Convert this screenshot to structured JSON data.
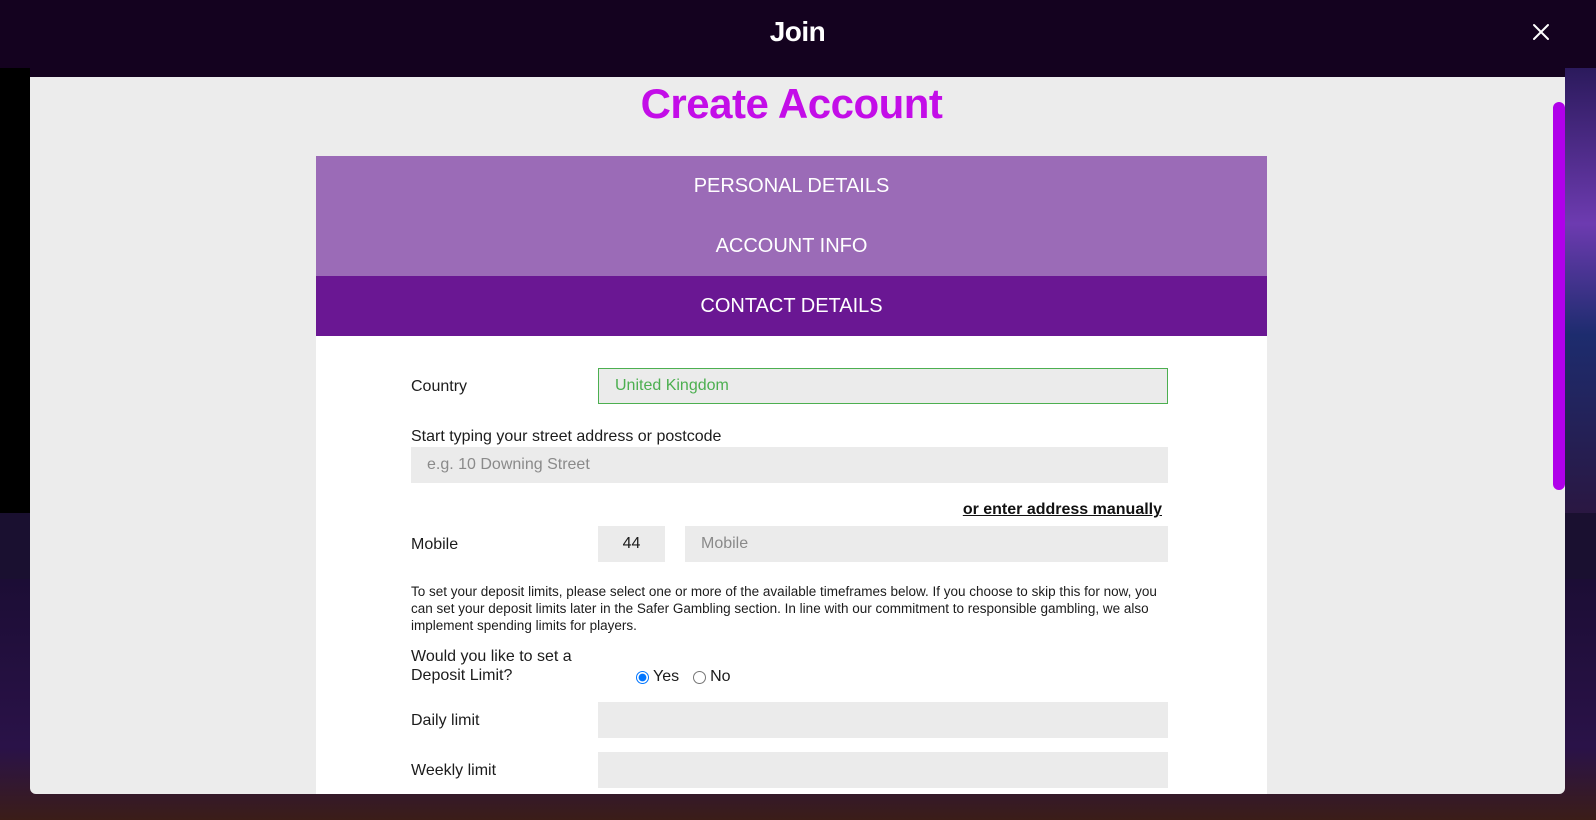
{
  "modal": {
    "title": "Join",
    "close_label": "close"
  },
  "page": {
    "heading": "Create Account"
  },
  "steps": [
    {
      "label": "PERSONAL DETAILS",
      "active": false
    },
    {
      "label": "ACCOUNT INFO",
      "active": false
    },
    {
      "label": "CONTACT DETAILS",
      "active": true
    }
  ],
  "form": {
    "country_label": "Country",
    "country_value": "United Kingdom",
    "address_label": "Start typing your street address or postcode",
    "address_placeholder": "e.g. 10 Downing Street",
    "manual_address_link": "or enter address manually",
    "mobile_label": "Mobile",
    "mobile_code": "44",
    "mobile_placeholder": "Mobile",
    "deposit_info": "To set your deposit limits, please select one or more of the available timeframes below. If you choose to skip this for now, you can set your deposit limits later in the Safer Gambling section. In line with our commitment to responsible gambling, we also implement spending limits for players.",
    "deposit_question": "Would you like to set a Deposit Limit?",
    "deposit_yes": "Yes",
    "deposit_no": "No",
    "deposit_selected": "Yes",
    "daily_limit_label": "Daily limit",
    "daily_limit_value": "",
    "weekly_limit_label": "Weekly limit",
    "weekly_limit_value": ""
  },
  "colors": {
    "header_bg": "#14021f",
    "heading": "#c30de8",
    "step_inactive": "#9b6bb7",
    "step_active": "#6a1793",
    "valid_green": "#4caf50",
    "scrollbar": "#b000ea"
  }
}
